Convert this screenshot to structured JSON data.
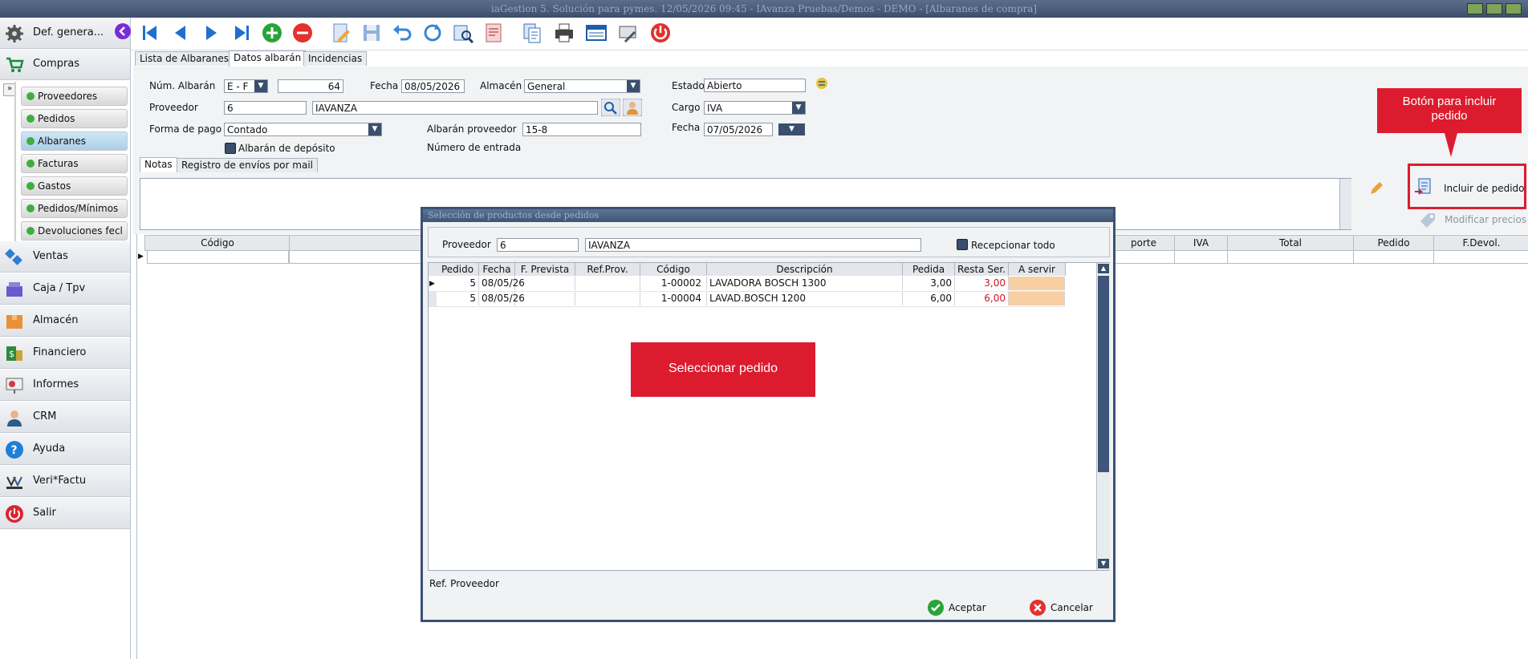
{
  "window": {
    "title": "iaGestion 5. Solución para pymes.  12/05/2026 09:45   -   IAvanza Pruebas/Demos - DEMO - [Albaranes de compra]"
  },
  "sidebar": {
    "top_label": "Def. genera...",
    "section": "Compras",
    "sub_items": [
      "Proveedores",
      "Pedidos",
      "Albaranes",
      "Facturas",
      "Gastos",
      "Pedidos/Mínimos",
      "Devoluciones fecl"
    ],
    "selected_sub": "Albaranes",
    "main_items": [
      "Ventas",
      "Caja / Tpv",
      "Almacén",
      "Financiero",
      "Informes",
      "CRM",
      "Ayuda",
      "Veri*Factu",
      "Salir"
    ]
  },
  "tabs": [
    "Lista de Albaranes",
    "Datos albarán",
    "Incidencias"
  ],
  "form": {
    "num_albaran_label": "Núm. Albarán",
    "serie": "E  - F",
    "numero": "64",
    "fecha_label": "Fecha",
    "fecha": "08/05/2026",
    "almacen_label": "Almacén",
    "almacen": "General",
    "estado_label": "Estado",
    "estado": "Abierto",
    "proveedor_label": "Proveedor",
    "proveedor_code": "6",
    "proveedor_name": "IAVANZA",
    "cargo_label": "Cargo",
    "cargo": "IVA",
    "forma_pago_label": "Forma de pago",
    "forma_pago": "Contado",
    "albaran_prov_label": "Albarán proveedor",
    "albaran_prov": "15-8",
    "fecha2_label": "Fecha",
    "fecha2": "07/05/2026",
    "deposito_label": "Albarán de depósito",
    "num_entrada_label": "Número de entrada"
  },
  "subtabs": [
    "Notas",
    "Registro de envíos por mail"
  ],
  "side_actions": {
    "incluir": "Incluir de pedido",
    "modificar": "Modificar precios"
  },
  "callout_top": "Botón para incluir pedido",
  "grid_headers": {
    "codigo": "Código",
    "importe": "porte",
    "iva": "IVA",
    "total": "Total",
    "pedido": "Pedido",
    "fdevol": "F.Devol."
  },
  "dialog": {
    "title": "Selección de productos desde pedidos",
    "proveedor_label": "Proveedor",
    "proveedor_code": "6",
    "proveedor_name": "IAVANZA",
    "recepcionar_label": "Recepcionar todo",
    "columns": [
      "Pedido",
      "Fecha",
      "F. Prevista",
      "Ref.Prov.",
      "Código",
      "Descripción",
      "Pedida",
      "Resta Ser.",
      "A servir"
    ],
    "rows": [
      {
        "pedido": "5",
        "fecha": "08/05/26",
        "f_prevista": "",
        "ref_prov": "",
        "codigo": "1-00002",
        "descripcion": "LAVADORA BOSCH 1300",
        "pedida": "3,00",
        "resta": "3,00",
        "a_servir": ""
      },
      {
        "pedido": "5",
        "fecha": "08/05/26",
        "f_prevista": "",
        "ref_prov": "",
        "codigo": "1-00004",
        "descripcion": "LAVAD.BOSCH 1200",
        "pedida": "6,00",
        "resta": "6,00",
        "a_servir": ""
      }
    ],
    "callout": "Seleccionar pedido",
    "ref_label": "Ref. Proveedor",
    "aceptar": "Aceptar",
    "cancelar": "Cancelar"
  }
}
